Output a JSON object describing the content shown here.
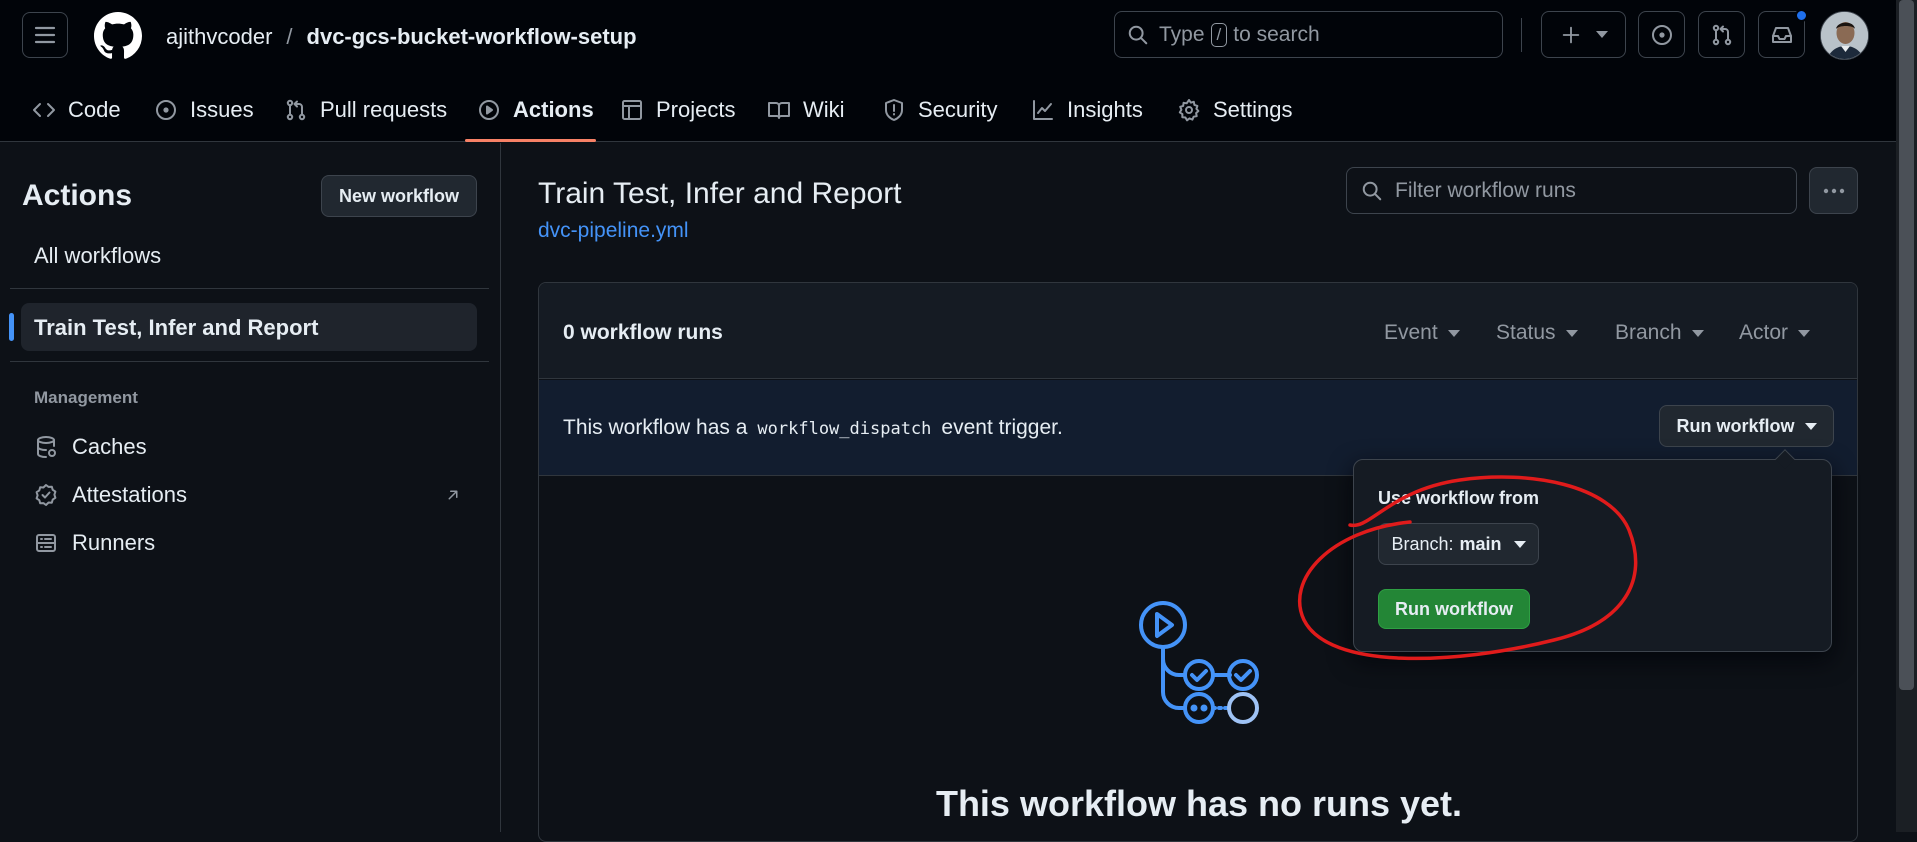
{
  "repo": {
    "owner": "ajithvcoder",
    "separator": "/",
    "name": "dvc-gcs-bucket-workflow-setup"
  },
  "search": {
    "prefix": "Type",
    "key": "/",
    "suffix": "to search"
  },
  "nav": {
    "tabs": [
      {
        "label": "Code"
      },
      {
        "label": "Issues"
      },
      {
        "label": "Pull requests"
      },
      {
        "label": "Actions"
      },
      {
        "label": "Projects"
      },
      {
        "label": "Wiki"
      },
      {
        "label": "Security"
      },
      {
        "label": "Insights"
      },
      {
        "label": "Settings"
      }
    ]
  },
  "sidebar": {
    "title": "Actions",
    "new_workflow": "New workflow",
    "all_workflows": "All workflows",
    "selected": "Train Test, Infer and Report",
    "management_heading": "Management",
    "management": [
      {
        "label": "Caches"
      },
      {
        "label": "Attestations"
      },
      {
        "label": "Runners"
      }
    ]
  },
  "main": {
    "title": "Train Test, Infer and Report",
    "file_link": "dvc-pipeline.yml",
    "filter_placeholder": "Filter workflow runs",
    "runs_count": "0 workflow runs",
    "filters": {
      "event": "Event",
      "status": "Status",
      "branch": "Branch",
      "actor": "Actor"
    },
    "dispatch": {
      "prefix": "This workflow has a",
      "code": "workflow_dispatch",
      "suffix": "event trigger.",
      "run_button": "Run workflow"
    },
    "popup": {
      "heading": "Use workflow from",
      "branch_label": "Branch:",
      "branch_value": "main",
      "run_button": "Run workflow"
    },
    "empty_state": "This workflow has no runs yet."
  },
  "colors": {
    "bg": "#0d1117",
    "header_bg": "#010409",
    "accent_blue": "#4493f8",
    "green": "#238636",
    "tab_underline": "#f78166",
    "annotation_red": "#e01b1b",
    "notification": "#1f6feb"
  }
}
